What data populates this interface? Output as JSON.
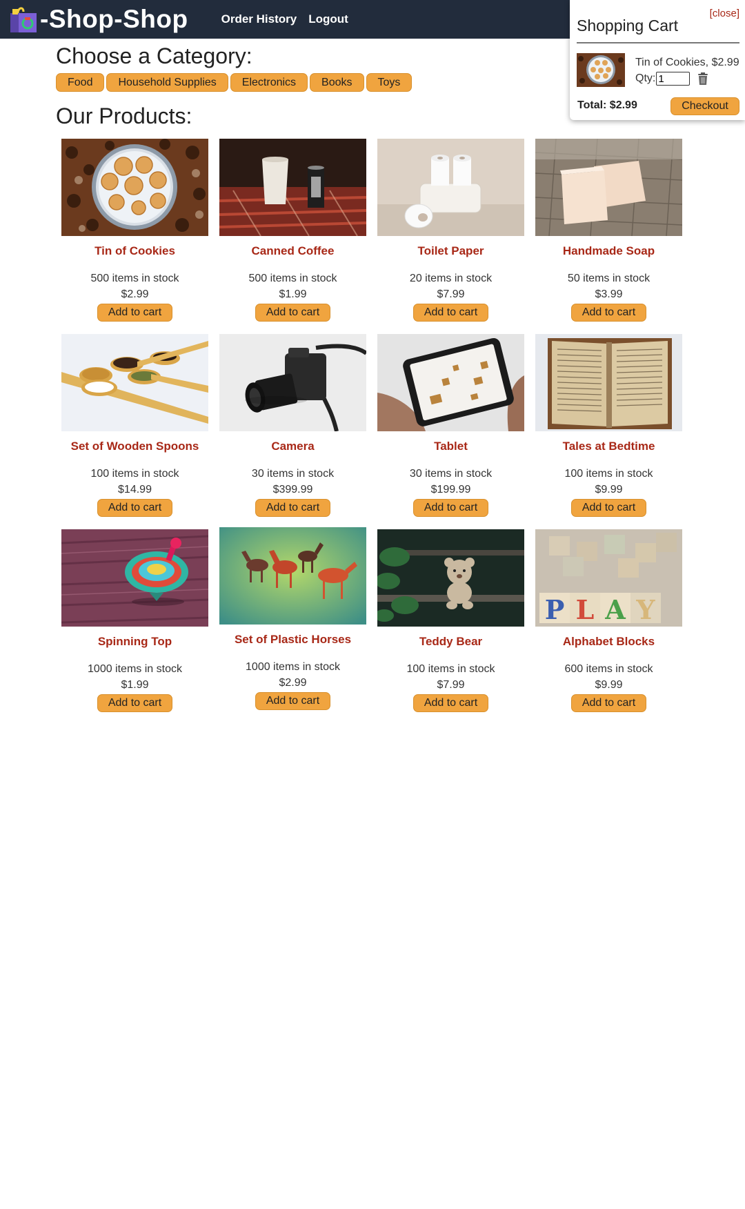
{
  "header": {
    "brand": "-Shop-Shop",
    "nav": [
      "Order History",
      "Logout"
    ]
  },
  "categories": {
    "title": "Choose a Category:",
    "items": [
      "Food",
      "Household Supplies",
      "Electronics",
      "Books",
      "Toys"
    ]
  },
  "products_section": {
    "title": "Our Products:",
    "add_label": "Add to cart",
    "items": [
      {
        "name": "Tin of Cookies",
        "stock": "500 items in stock",
        "price": "$2.99",
        "image": "cookies-tin"
      },
      {
        "name": "Canned Coffee",
        "stock": "500 items in stock",
        "price": "$1.99",
        "image": "canned-coffee"
      },
      {
        "name": "Toilet Paper",
        "stock": "20 items in stock",
        "price": "$7.99",
        "image": "toilet-paper"
      },
      {
        "name": "Handmade Soap",
        "stock": "50 items in stock",
        "price": "$3.99",
        "image": "soap"
      },
      {
        "name": "Set of Wooden Spoons",
        "stock": "100 items in stock",
        "price": "$14.99",
        "image": "wooden-spoons"
      },
      {
        "name": "Camera",
        "stock": "30 items in stock",
        "price": "$399.99",
        "image": "camera"
      },
      {
        "name": "Tablet",
        "stock": "30 items in stock",
        "price": "$199.99",
        "image": "tablet"
      },
      {
        "name": "Tales at Bedtime",
        "stock": "100 items in stock",
        "price": "$9.99",
        "image": "open-book"
      },
      {
        "name": "Spinning Top",
        "stock": "1000 items in stock",
        "price": "$1.99",
        "image": "spinning-top"
      },
      {
        "name": "Set of Plastic Horses",
        "stock": "1000 items in stock",
        "price": "$2.99",
        "image": "plastic-horses"
      },
      {
        "name": "Teddy Bear",
        "stock": "100 items in stock",
        "price": "$7.99",
        "image": "teddy-bear"
      },
      {
        "name": "Alphabet Blocks",
        "stock": "600 items in stock",
        "price": "$9.99",
        "image": "alphabet-blocks"
      }
    ]
  },
  "cart": {
    "close_label": "[close]",
    "title": "Shopping Cart",
    "items": [
      {
        "text": "Tin of Cookies, $2.99",
        "qty_label": "Qty:",
        "qty": "1",
        "image": "cookies-tin"
      }
    ],
    "total": "Total: $2.99",
    "checkout_label": "Checkout"
  },
  "colors": {
    "header_bg": "#222c3c",
    "accent_button": "#f0a43f",
    "product_name": "#a82817"
  }
}
